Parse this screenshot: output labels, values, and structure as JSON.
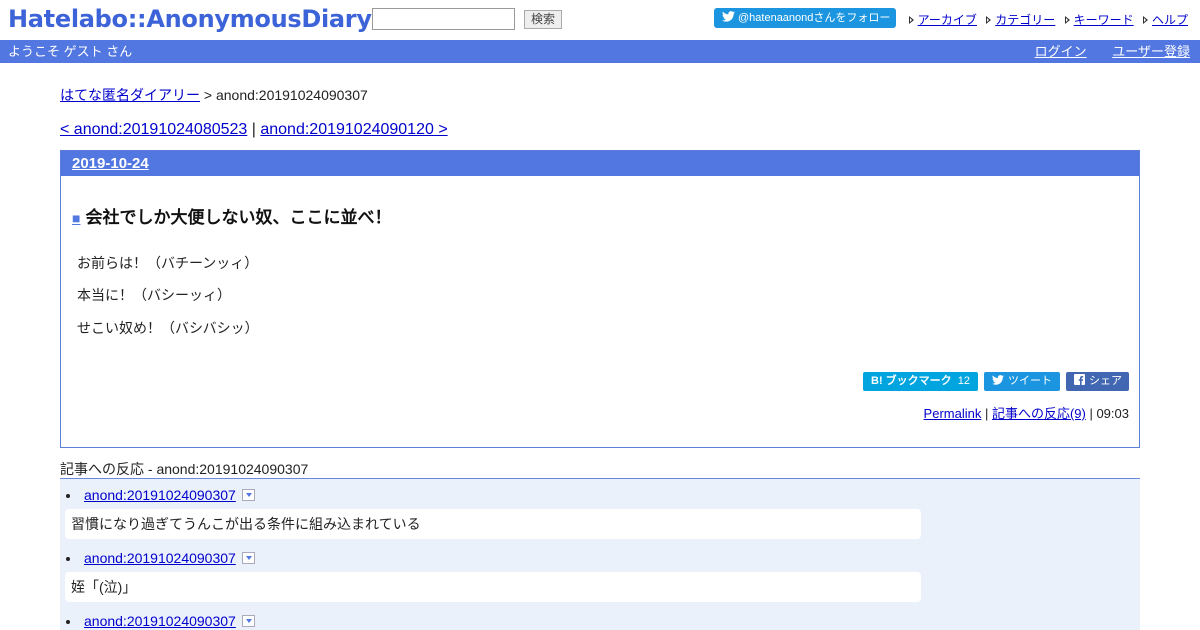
{
  "header": {
    "logo": "Hatelabo::AnonymousDiary",
    "search_value": "",
    "search_button": "検索",
    "follow_button": "@hatenaanondさんをフォロー",
    "links": [
      "アーカイブ",
      "カテゴリー",
      "キーワード",
      "ヘルプ"
    ]
  },
  "userbar": {
    "welcome": "ようこそ ゲスト さん",
    "login": "ログイン",
    "register": "ユーザー登録"
  },
  "breadcrumb": {
    "home": "はてな匿名ダイアリー",
    "separator": " > ",
    "current": "anond:20191024090307"
  },
  "pager": {
    "prev": "< anond:20191024080523",
    "separator": " | ",
    "next": "anond:20191024090120 >"
  },
  "day": {
    "date": "2019-10-24",
    "entry": {
      "marker": "■",
      "title": "会社でしか大便しない奴、ここに並べ！",
      "lines": [
        "お前らは！（バチーンッィ）",
        "本当に！（バシーッィ）",
        "せこい奴め！（バシバシッ）"
      ],
      "share": {
        "bookmark_label": "B! ブックマーク",
        "bookmark_count": "12",
        "tweet": "ツイート",
        "facebook": "シェア"
      },
      "footer": {
        "permalink": "Permalink",
        "sep1": " | ",
        "reactions_link": "記事への反応(9)",
        "sep2": " | ",
        "time": "09:03"
      }
    }
  },
  "reactions": {
    "title": "記事への反応 - anond:20191024090307",
    "items": [
      {
        "link": "anond:20191024090307",
        "comment": "習慣になり過ぎてうんこが出る条件に組み込まれている"
      },
      {
        "link": "anond:20191024090307",
        "comment": "姪「(泣)」"
      },
      {
        "link": "anond:20191024090307",
        "comment": ""
      }
    ]
  },
  "colors": {
    "brand_blue": "#3c63d8",
    "bar_blue": "#5277e0",
    "twitter": "#1b95e0",
    "hatena_bookmark": "#00a4de",
    "facebook": "#4267b2",
    "reaction_bg": "#ebf1fb"
  }
}
